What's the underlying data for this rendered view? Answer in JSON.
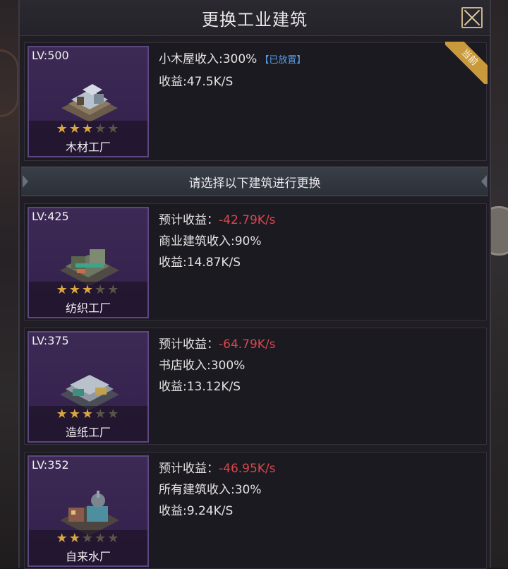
{
  "dialog": {
    "title": "更换工业建筑"
  },
  "current": {
    "level": "LV:500",
    "stars": 3,
    "max_stars": 5,
    "name": "木材工厂",
    "bonus": "小木屋收入:300%",
    "tag": "【已放置】",
    "income": "收益:47.5K/S",
    "ribbon": "当前"
  },
  "divider_text": "请选择以下建筑进行更换",
  "options": [
    {
      "level": "LV:425",
      "stars": 3,
      "name": "纺织工厂",
      "expected_label": "预计收益：",
      "expected_value": "-42.79K/s",
      "bonus": "商业建筑收入:90%",
      "income": "收益:14.87K/S"
    },
    {
      "level": "LV:375",
      "stars": 3,
      "name": "造纸工厂",
      "expected_label": "预计收益：",
      "expected_value": "-64.79K/s",
      "bonus": "书店收入:300%",
      "income": "收益:13.12K/S"
    },
    {
      "level": "LV:352",
      "stars": 2,
      "name": "自来水厂",
      "expected_label": "预计收益：",
      "expected_value": "-46.95K/s",
      "bonus": "所有建筑收入:30%",
      "income": "收益:9.24K/S"
    }
  ],
  "colors": {
    "negative": "#d9474d",
    "tag": "#5aa0e8",
    "star": "#d9a640",
    "ribbon": "#c99a3c"
  },
  "icons": [
    "close-icon",
    "star-icon",
    "building-icon"
  ]
}
